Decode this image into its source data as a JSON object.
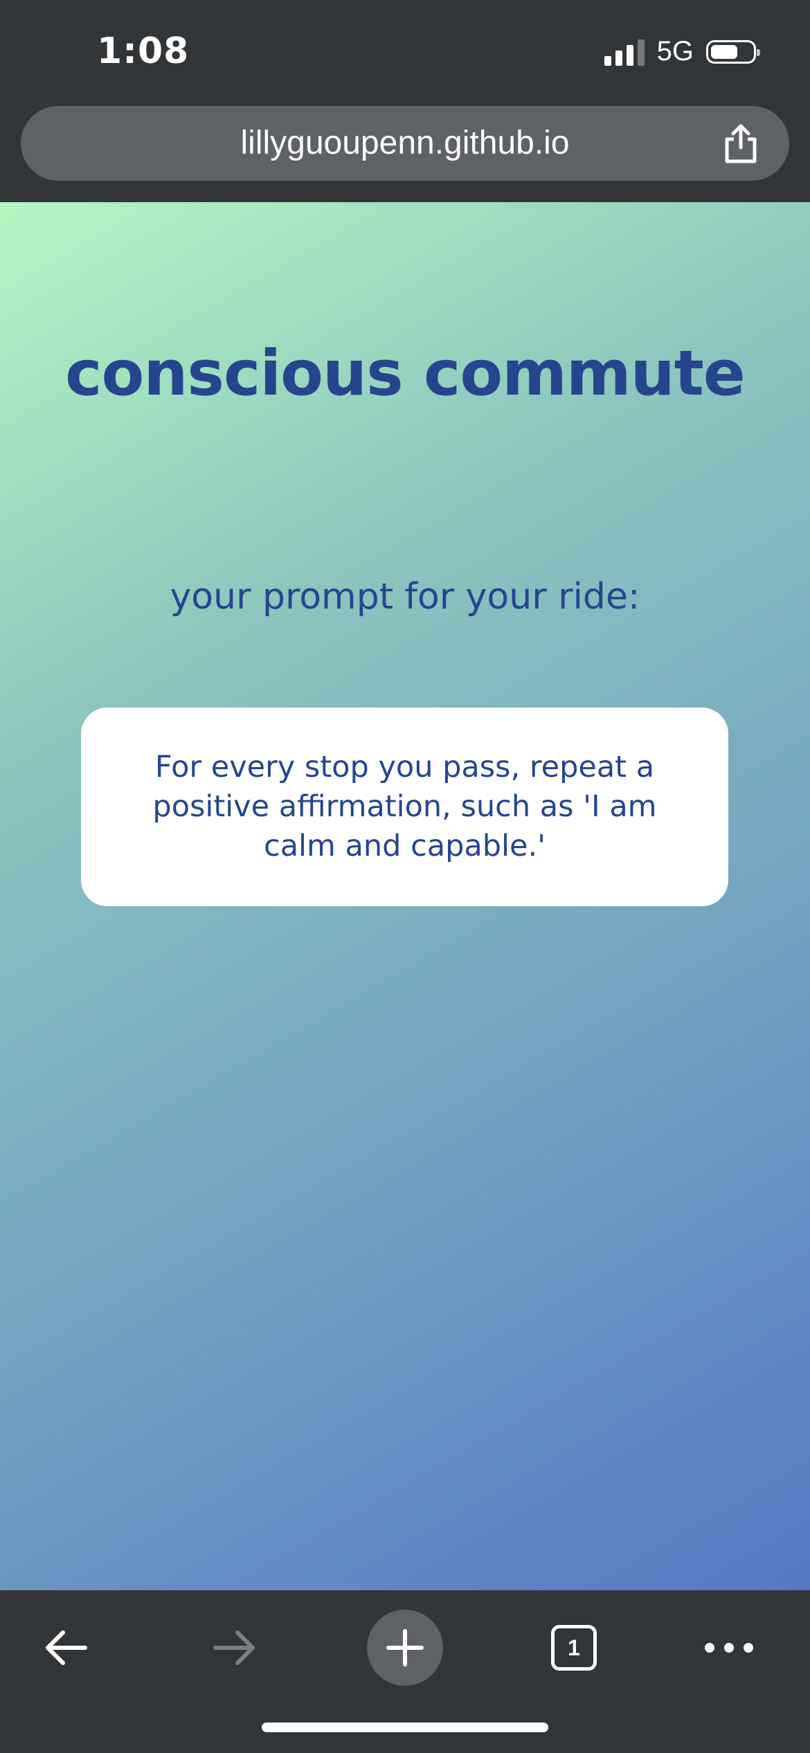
{
  "status_bar": {
    "time": "1:08",
    "network": "5G",
    "battery_level": 0.7
  },
  "browser": {
    "url": "lillyguoupenn.github.io",
    "share_icon": "share-icon",
    "toolbar": {
      "back_icon": "arrow-left-icon",
      "forward_icon": "arrow-right-icon",
      "new_tab_icon": "plus-icon",
      "tab_count": "1",
      "menu_icon": "more-horizontal-icon"
    }
  },
  "page": {
    "title": "conscious commute",
    "prompt_label": "your prompt for your ride:",
    "prompt_text": "For every stop you pass, repeat a positive affirmation, such as 'I am calm and capable.'"
  },
  "colors": {
    "text_accent": "#26458e",
    "gradient_start": "#b3f7c2",
    "gradient_end": "#5677c3",
    "chrome_bg": "#323538",
    "url_bar_bg": "#5e6165"
  }
}
